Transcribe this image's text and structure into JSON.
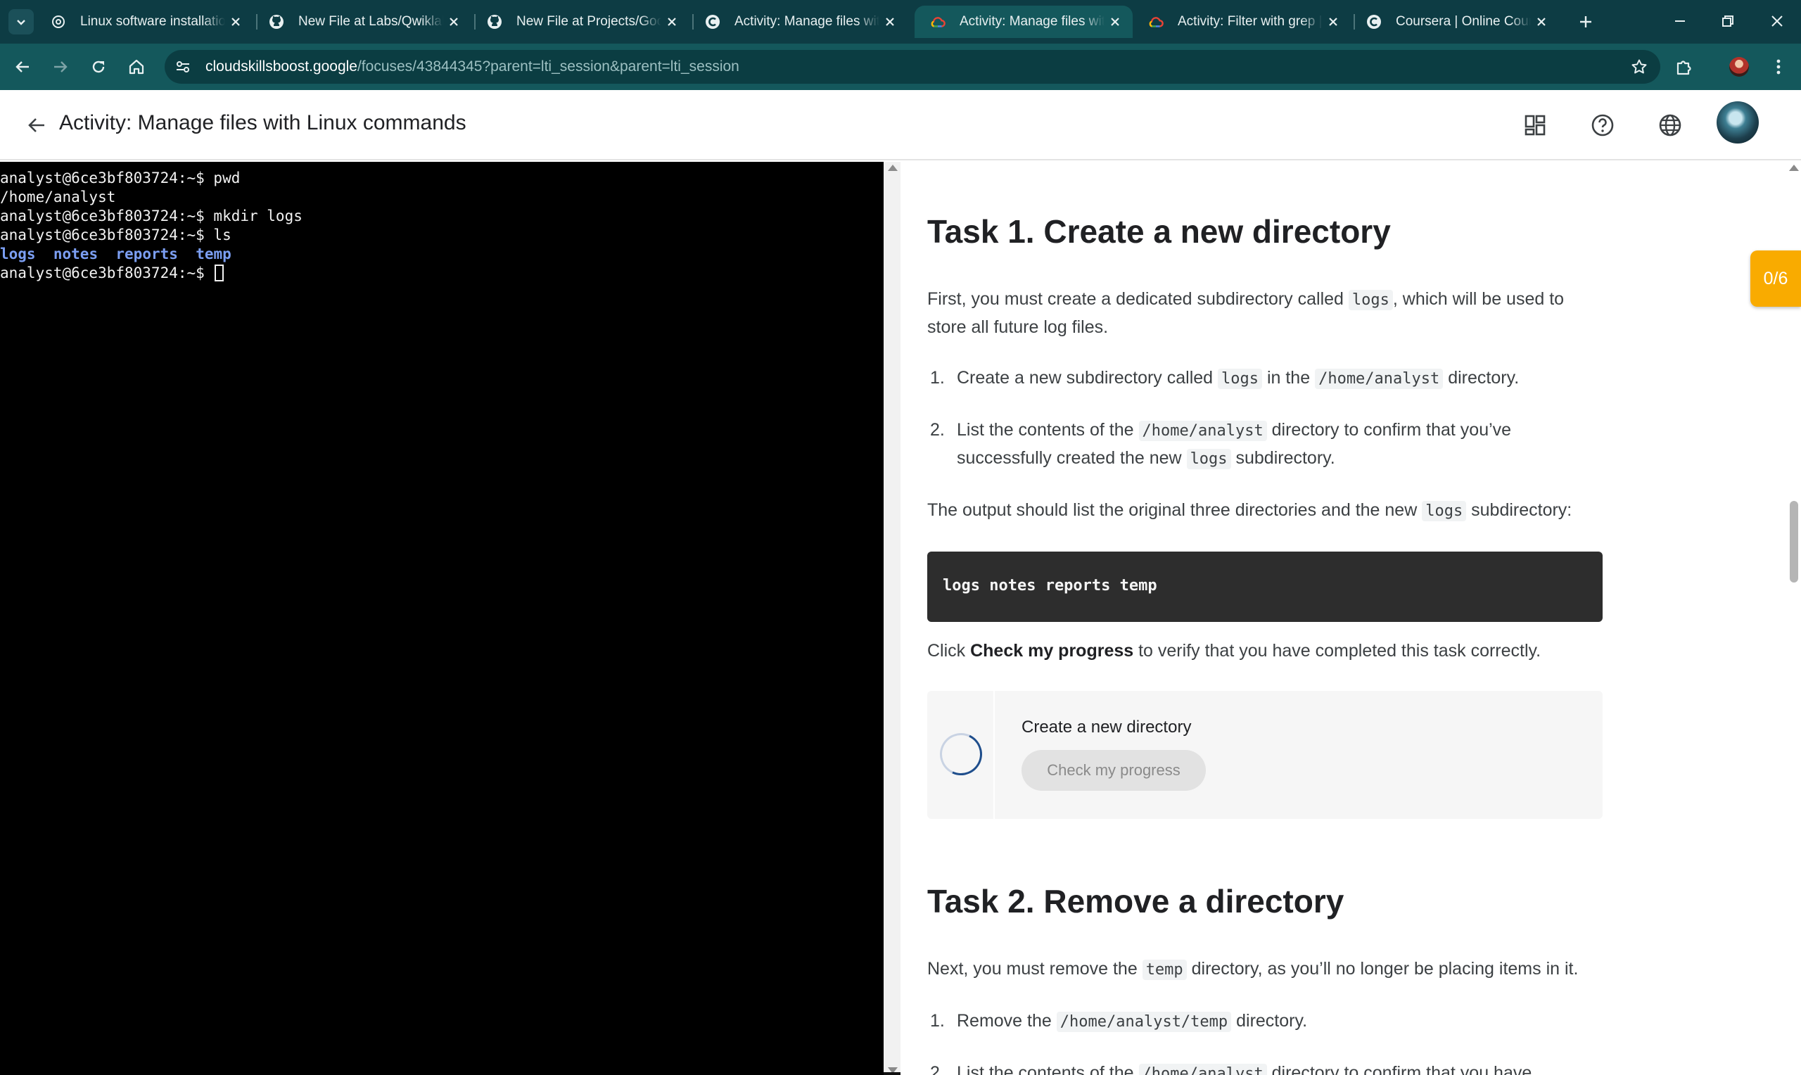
{
  "browser": {
    "tabs": [
      {
        "title": "Linux software installation",
        "favicon": "openai-icon",
        "active": false
      },
      {
        "title": "New File at Labs/Qwiklabs",
        "favicon": "github-icon",
        "active": false
      },
      {
        "title": "New File at Projects/Google",
        "favicon": "github-icon",
        "active": false
      },
      {
        "title": "Activity: Manage files with",
        "favicon": "coursera-icon",
        "active": false
      },
      {
        "title": "Activity: Manage files with",
        "favicon": "google-cloud-icon",
        "active": true
      },
      {
        "title": "Activity: Filter with grep |",
        "favicon": "google-cloud-icon",
        "active": false
      },
      {
        "title": "Coursera | Online Courses",
        "favicon": "coursera-icon",
        "active": false
      }
    ],
    "url_host": "cloudskillsboost.google",
    "url_path": "/focuses/43844345?parent=lti_session&parent=lti_session"
  },
  "header": {
    "title": "Activity: Manage files with Linux commands"
  },
  "terminal": {
    "lines": [
      "analyst@6ce3bf803724:~$ pwd",
      "/home/analyst",
      "analyst@6ce3bf803724:~$ mkdir logs",
      "analyst@6ce3bf803724:~$ ls",
      "analyst@6ce3bf803724:~$ "
    ],
    "ls_output": [
      "logs",
      "notes",
      "reports",
      "temp"
    ]
  },
  "lab": {
    "progress": "0/6",
    "task1": {
      "heading": "Task 1. Create a new directory",
      "intro_a": "First, you must create a dedicated subdirectory called ",
      "intro_code": "logs",
      "intro_b": ", which will be used to store all future log files.",
      "step1_num": "1.",
      "step1_a": "Create a new subdirectory called ",
      "step1_code1": "logs",
      "step1_b": " in the ",
      "step1_code2": "/home/analyst",
      "step1_c": " directory.",
      "step2_num": "2.",
      "step2_a": "List the contents of the ",
      "step2_code": "/home/analyst",
      "step2_b": " directory to confirm that you’ve successfully created the new ",
      "step2_code2": "logs",
      "step2_c": " subdirectory.",
      "output_a": "The output should list the original three directories and the new ",
      "output_code": "logs",
      "output_b": " subdirectory:",
      "codeblock": "logs notes reports temp",
      "click_a": "Click ",
      "click_bold": "Check my progress",
      "click_b": " to verify that you have completed this task correctly.",
      "check_title": "Create a new directory",
      "check_button": "Check my progress"
    },
    "task2": {
      "heading": "Task 2. Remove a directory",
      "intro_a": "Next, you must remove the ",
      "intro_code": "temp",
      "intro_b": " directory, as you’ll no longer be placing items in it.",
      "step1_num": "1.",
      "step1_a": "Remove the ",
      "step1_code": "/home/analyst/temp",
      "step1_b": " directory.",
      "step2_num": "2.",
      "step2_a": "List the contents of the ",
      "step2_code": "/home/analyst",
      "step2_b": " directory to confirm that you have"
    }
  }
}
